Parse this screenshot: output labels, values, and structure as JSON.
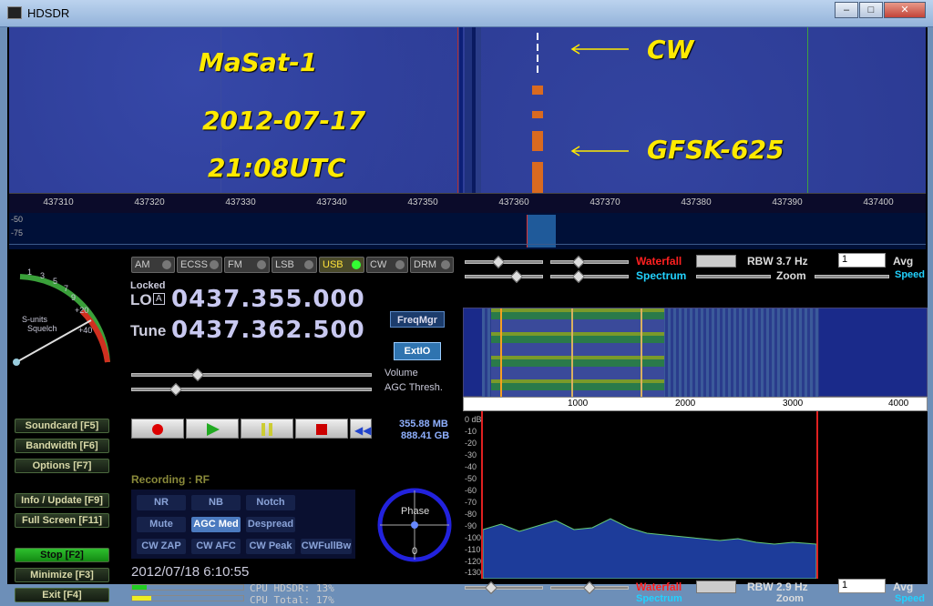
{
  "window": {
    "title": "HDSDR",
    "min": "‒",
    "max": "□",
    "close": "✕"
  },
  "waterfall": {
    "annotations": {
      "satellite": "MaSat-1",
      "date": "2012-07-17",
      "time": "21:08UTC",
      "cw": "CW",
      "gfsk": "GFSK-625"
    },
    "scale": [
      "437310",
      "437320",
      "437330",
      "437340",
      "437350",
      "437360",
      "437370",
      "437380",
      "437390",
      "437400"
    ]
  },
  "spectrum_levels": [
    "-50",
    "-75"
  ],
  "smeter": {
    "label1": "S-units",
    "label2": "Squelch",
    "scale": [
      "1",
      "3",
      "5",
      "7",
      "9",
      "+20",
      "+40"
    ]
  },
  "modes": [
    "AM",
    "ECSS",
    "FM",
    "LSB",
    "USB",
    "CW",
    "DRM"
  ],
  "active_mode": "USB",
  "lo": {
    "locked": "Locked",
    "label": "LO",
    "a": "A",
    "value": "0437.355.000"
  },
  "tune": {
    "label": "Tune",
    "value": "0437.362.500"
  },
  "freqmgr": "FreqMgr",
  "extio": "ExtIO",
  "volume": "Volume",
  "agc_thresh": "AGC Thresh.",
  "storage": {
    "mb": "355.88 MB",
    "gb": "888.41 GB"
  },
  "side_buttons": {
    "soundcard": "Soundcard [F5]",
    "bandwidth": "Bandwidth [F6]",
    "options": "Options   [F7]",
    "info": "Info / Update [F9]",
    "fullscreen": "Full Screen [F11]",
    "stop": "Stop      [F2]",
    "minimize": "Minimize [F3]",
    "exit": "Exit      [F4]"
  },
  "recording": "Recording : RF",
  "dsp": {
    "nr": "NR",
    "nb": "NB",
    "notch": "Notch",
    "mute": "Mute",
    "agc": "AGC Med",
    "despread": "Despread",
    "cwzap": "CW ZAP",
    "cwafc": "CW AFC",
    "cwpeak": "CW Peak",
    "cwfull": "CWFullBw"
  },
  "phase": {
    "label": "Phase",
    "zero": "0"
  },
  "datetime": "2012/07/18 6:10:55",
  "cpu": {
    "hdsdr": "CPU HDSDR: 13%",
    "total": "CPU Total: 17%",
    "hdsdr_level": 0.13,
    "total_level": 0.17
  },
  "top_panel": {
    "waterfall": "Waterfall",
    "spectrum": "Spectrum",
    "zoom": "Zoom",
    "rbw": "RBW  3.7 Hz",
    "avg": "Avg",
    "speed": "Speed",
    "avg_value": "1"
  },
  "bottom_panel": {
    "waterfall": "Waterfall",
    "spectrum": "Spectrum",
    "zoom": "Zoom",
    "rbw": "RBW  2.9 Hz",
    "avg": "Avg",
    "speed": "Speed",
    "avg_value": "1"
  },
  "af_scale": [
    "1000",
    "2000",
    "3000",
    "4000"
  ],
  "af_levels": [
    "0 dB",
    "-10",
    "-20",
    "-30",
    "-40",
    "-50",
    "-60",
    "-70",
    "-80",
    "-90",
    "-100",
    "-110",
    "-120",
    "-130"
  ],
  "colors": {
    "waterfall_bg": "#2c3b94",
    "annotation": "#ffea00",
    "waterfall_label": "#ff2020",
    "spectrum_label": "#22d2ff"
  }
}
